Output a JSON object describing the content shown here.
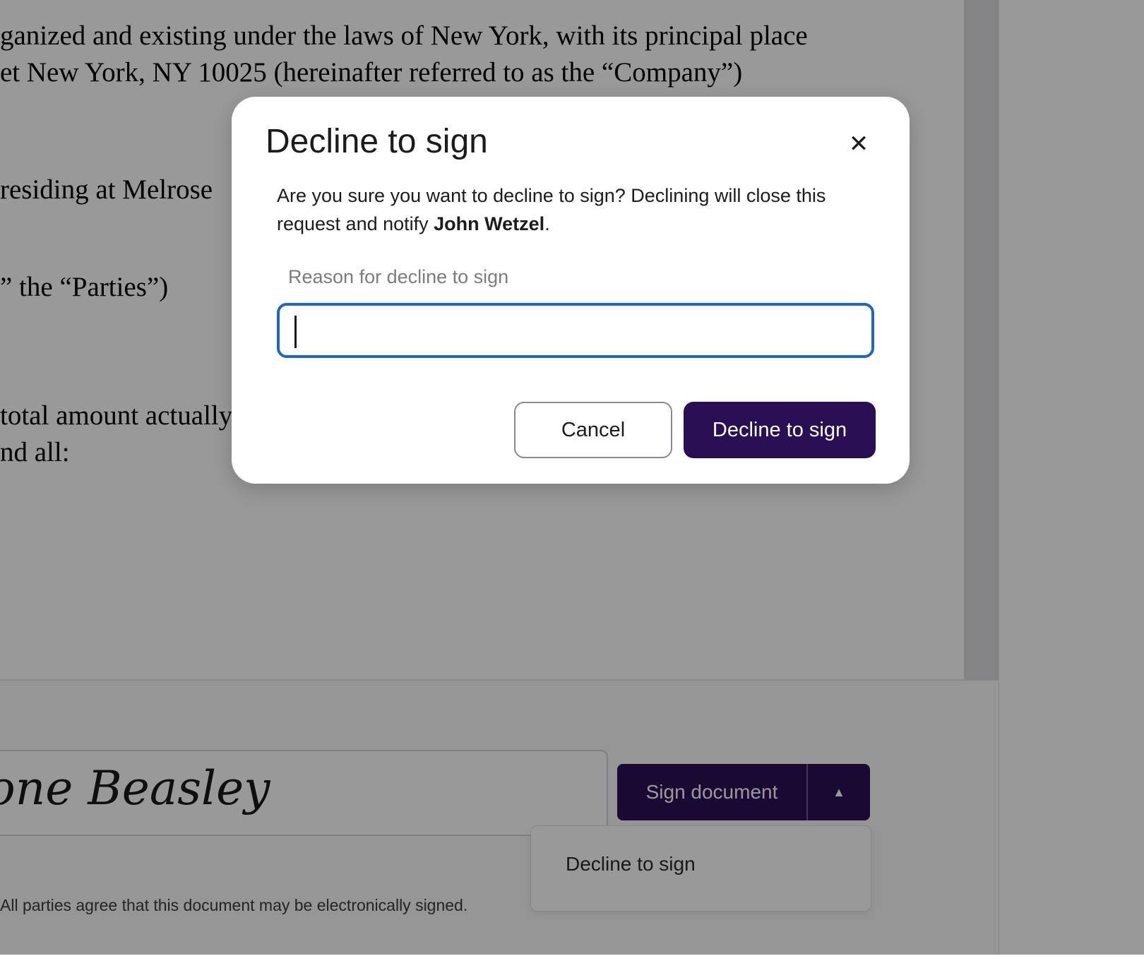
{
  "document": {
    "lines": [
      "ganized and existing under the laws of New York, with its principal place",
      "et New York, NY 10025 (hereinafter referred to as the “Company”)",
      " residing at Melrose",
      "” the “Parties”)",
      "total amount actually",
      "nd all:"
    ]
  },
  "footer": {
    "signature_name": "one Beasley",
    "sign_button_label": "Sign document",
    "dropdown_item_label": "Decline to sign",
    "legal_note": "All parties agree that this document may be electronically signed."
  },
  "modal": {
    "title": "Decline to sign",
    "message_prefix": "Are you sure you want to decline to sign? Declining will close this request and notify ",
    "message_name": "John Wetzel",
    "message_suffix": ".",
    "field_label": "Reason for decline to sign",
    "input_value": "",
    "cancel_label": "Cancel",
    "confirm_label": "Decline to sign"
  },
  "icons": {
    "close": "✕",
    "caret_up": "▲"
  },
  "colors": {
    "primary": "#2a0f55",
    "focus": "#1f66c2"
  }
}
